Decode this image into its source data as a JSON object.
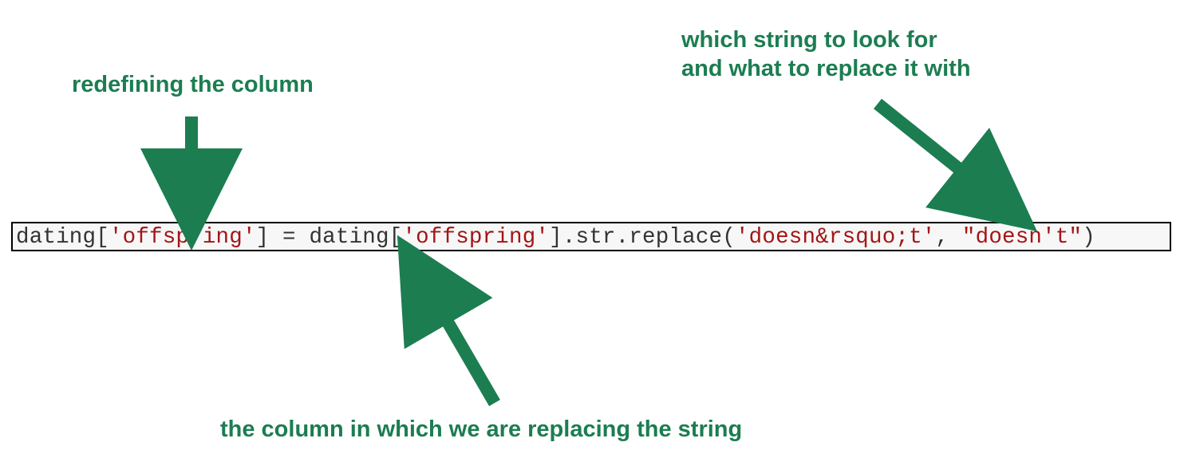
{
  "annotations": {
    "top_left": "redefining the column",
    "top_right_line1": "which string to look for",
    "top_right_line2": "and what to replace it with",
    "bottom": "the column in which we are replacing the string"
  },
  "code": {
    "t1": "dating[",
    "s1": "'offspring'",
    "t2": "] = dating[",
    "s2": "'offspring'",
    "t3": "].str.replace(",
    "s3": "'doesn&rsquo;t'",
    "t4": ", ",
    "s4": "\"doesn't\"",
    "t5": ")"
  },
  "colors": {
    "annotation": "#1c7d51",
    "string": "#a31515",
    "code_bg": "#f7f7f7"
  }
}
